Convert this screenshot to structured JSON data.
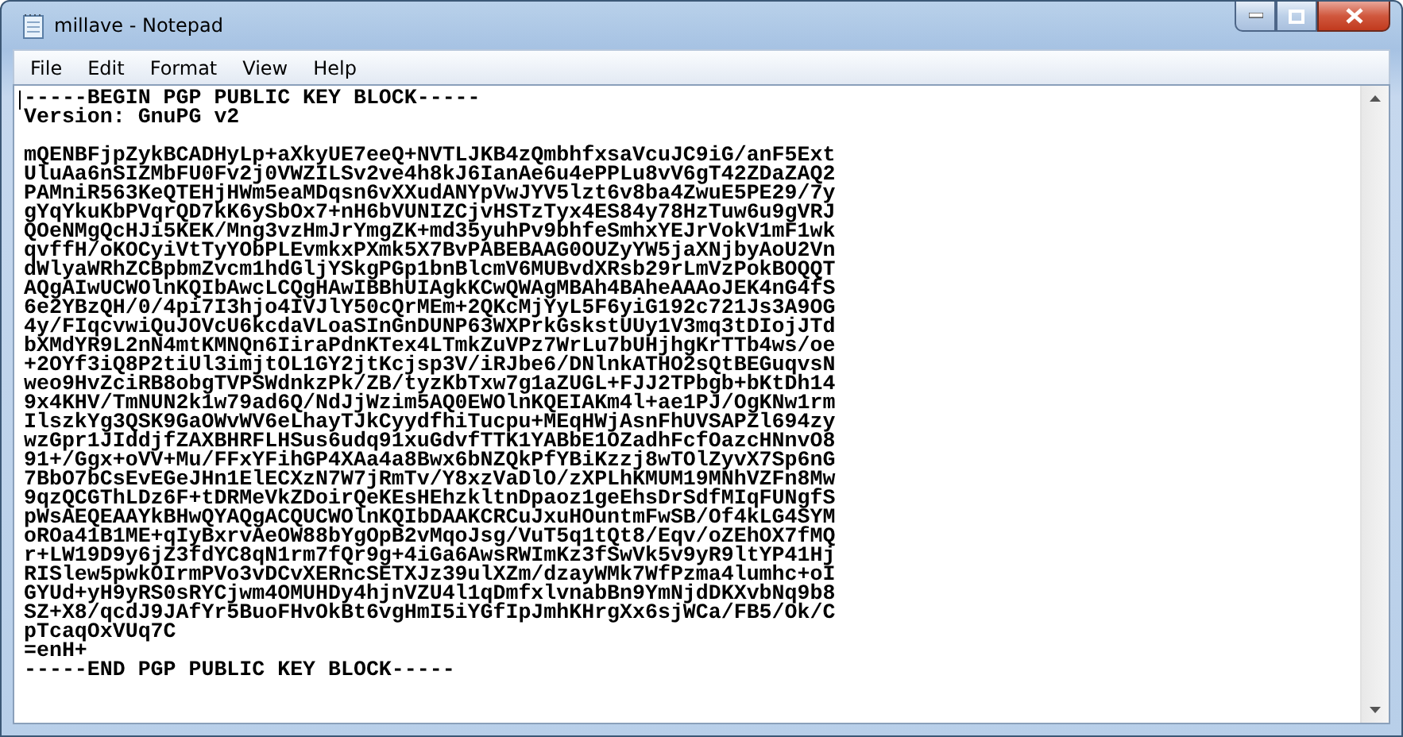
{
  "window": {
    "title": "millave - Notepad"
  },
  "menu": [
    {
      "label": "File"
    },
    {
      "label": "Edit"
    },
    {
      "label": "Format"
    },
    {
      "label": "View"
    },
    {
      "label": "Help"
    }
  ],
  "document": {
    "text": "-----BEGIN PGP PUBLIC KEY BLOCK-----\nVersion: GnuPG v2\n\nmQENBFjpZykBCADHyLp+aXkyUE7eeQ+NVTLJKB4zQmbhfxsaVcuJC9iG/anF5Ext\nUluAa6nSIZMbFU0Fv2j0VWZILSv2ve4h8kJ6IanAe6u4ePPLu8vV6gT42ZDaZAQ2\nPAMniR563KeQTEHjHWm5eaMDqsn6vXXudANYpVwJYV5lzt6v8ba4ZwuE5PE29/7y\ngYqYkuKbPVqrQD7kK6ySbOx7+nH6bVUNIZCjvHSTzTyx4ES84y78HzTuw6u9gVRJ\nQOeNMgQcHJi5KEK/Mng3vzHmJrYmgZK+md35yuhPv9bhfeSmhxYEJrVokV1mF1wk\nqvffH/oKOCyiVtTyYObPLEvmkxPXmk5X7BvPABEBAAG0OUZyYW5jaXNjbyAoU2Vn\ndWlyaWRhZCBpbmZvcm1hdGljYSkgPGp1bnBlcmV6MUBvdXRsb29rLmVzPokBOQQT\nAQgAIwUCWOlnKQIbAwcLCQgHAwIBBhUIAgkKCwQWAgMBAh4BAheAAAoJEK4nG4fS\n6e2YBzQH/0/4pi7I3hjo4IVJlY50cQrMEm+2QKcMjYyL5F6yiG192c721Js3A9OG\n4y/FIqcvwiQuJOVcU6kcdaVLoaSInGnDUNP63WXPrkGskstUUy1V3mq3tDIojJTd\nbXMdYR9L2nN4mtKMNQn6IiraPdnKTex4LTmkZuVPz7WrLu7bUHjhgKrTTb4ws/oe\n+2OYf3iQ8P2tiUl3imjtOL1GY2jtKcjsp3V/iRJbe6/DNlnkATHO2sQtBEGuqvsN\nweo9HvZciRB8obgTVPSWdnkzPk/ZB/tyzKbTxw7g1aZUGL+FJJ2TPbgb+bKtDh14\n9x4KHV/TmNUN2k1w79ad6Q/NdJjWzim5AQ0EWOlnKQEIAKm4l+ae1PJ/OgKNw1rm\nIlszkYg3QSK9GaOWvWV6eLhayTJkCyydfhiTucpu+MEqHWjAsnFhUVSAPZl694zy\nwzGpr1JIddjfZAXBHRFLHSus6udq91xuGdvfTTK1YABbE1OZadhFcfOazcHNnvO8\n91+/Ggx+oVV+Mu/FFxYFihGP4XAa4a8Bwx6bNZQkPfYBiKzzj8wTOlZyvX7Sp6nG\n7BbO7bCsEvEGeJHn1ElECXzN7W7jRmTv/Y8xzVaDlO/zXPLhKMUM19MNhVZFn8Mw\n9qzQCGThLDz6F+tDRMeVkZDoirQeKEsHEhzkltnDpaoz1geEhsDrSdfMIqFUNgfS\npWsAEQEAAYkBHwQYAQgACQUCWOlnKQIbDAAKCRCuJxuHOuntmFwSB/Of4kLG4SYM\noROa41B1ME+qIyBxrvAeOW88bYgOpB2vMqoJsg/VuT5q1tQt8/Eqv/oZEhOX7fMQ\nr+LW19D9y6jZ3fdYC8qN1rm7fQr9g+4iGa6AwsRWImKz3fSwVk5v9yR9ltYP41Hj\nRISlew5pwkOIrmPVo3vDCvXERncSETXJz39ulXZm/dzayWMk7WfPzma4lumhc+oI\nGYUd+yH9yRS0sRYCjwm4OMUHDy4hjnVZU4l1qDmfxlvnabBn9YmNjdDKXvbNq9b8\nSZ+X8/qcdJ9JAfYr5BuoFHvOkBt6vgHmI5iYGfIpJmhKHrgXx6sjWCa/FB5/Ok/C\npTcaqOxVUq7C\n=enH+\n-----END PGP PUBLIC KEY BLOCK-----"
  }
}
